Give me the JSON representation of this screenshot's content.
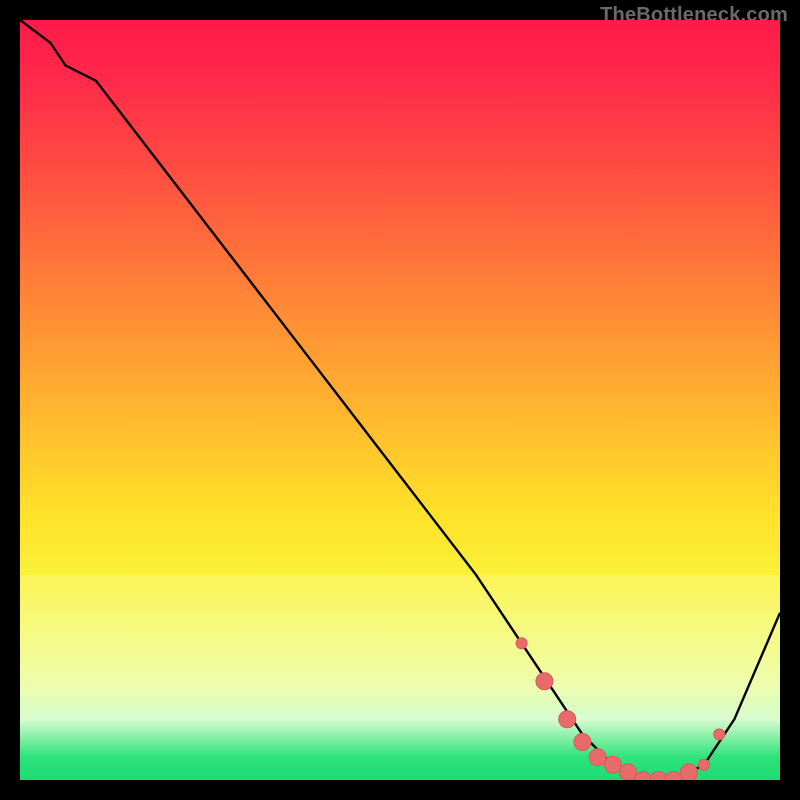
{
  "attribution": "TheBottleneck.com",
  "colors": {
    "page_bg": "#000000",
    "gradient_top": "#ff1a4b",
    "gradient_mid": "#ffe22a",
    "gradient_bottom": "#1edc72",
    "curve_stroke": "#000000",
    "marker_fill": "#e86b6b",
    "marker_stroke": "#d85a5a"
  },
  "chart_data": {
    "type": "line",
    "title": "",
    "xlabel": "",
    "ylabel": "",
    "xlim": [
      0,
      100
    ],
    "ylim": [
      0,
      100
    ],
    "grid": false,
    "legend": false,
    "series": [
      {
        "name": "curve",
        "x": [
          0,
          4,
          6,
          10,
          20,
          30,
          40,
          50,
          60,
          66,
          70,
          74,
          78,
          82,
          86,
          90,
          94,
          100
        ],
        "y": [
          100,
          97,
          94,
          92,
          79,
          66,
          53,
          40,
          27,
          18,
          12,
          6,
          2,
          0,
          0,
          2,
          8,
          22
        ]
      }
    ],
    "markers": {
      "name": "highlight-dots",
      "x": [
        66,
        69,
        72,
        74,
        76,
        78,
        80,
        82,
        84,
        86,
        88,
        90,
        92
      ],
      "y": [
        18,
        13,
        8,
        5,
        3,
        2,
        1,
        0,
        0,
        0,
        1,
        2,
        6
      ],
      "size_hint": "varied-small"
    }
  }
}
